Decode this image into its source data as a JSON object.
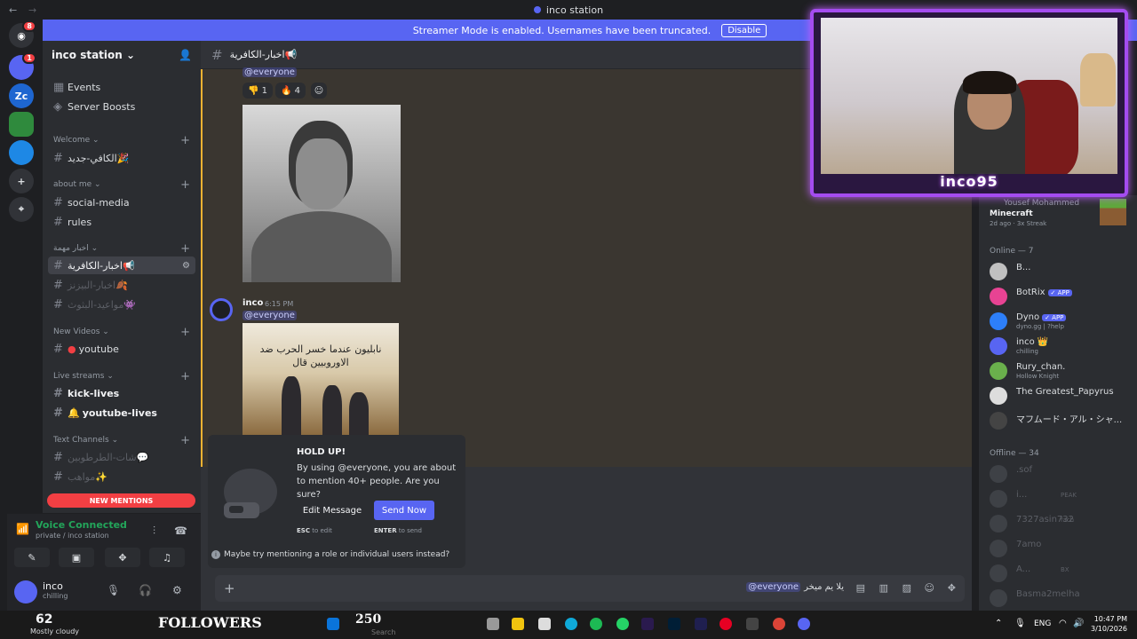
{
  "window": {
    "title": "inco station",
    "back": "←",
    "forward": "→"
  },
  "streamer_banner": {
    "text": "Streamer Mode is enabled. Usernames have been truncated.",
    "button": "Disable"
  },
  "guilds": [
    {
      "label": "",
      "ping": "8",
      "color": "#313338"
    },
    {
      "label": "",
      "ping": "1",
      "color": "#5865f2"
    },
    {
      "label": "Zc",
      "ping": "",
      "color": "#1e66d0"
    },
    {
      "label": "",
      "ping": "",
      "color": "#2f8a3d"
    },
    {
      "label": "",
      "ping": "",
      "color": "#1e88e5"
    },
    {
      "label": "+",
      "ping": "",
      "color": "#313338"
    },
    {
      "label": "⌖",
      "ping": "",
      "color": "#313338"
    }
  ],
  "server": {
    "name": "inco station",
    "chevron": "⌄"
  },
  "sidebar": {
    "events": "Events",
    "boosts": "Server Boosts",
    "welcome_cat": "Welcome",
    "welcome_channel": "الكافي-جديد🎉",
    "aboutme_cat": "about me",
    "social": "social-media",
    "rules": "rules",
    "news_cat": "اخبار مهمة",
    "news_active": "اخبار-الكافرية📢",
    "news2": "اخبار-البيزنز🍂",
    "news3": "مواعيد-البثوث👾",
    "videos_cat": "New Videos",
    "youtube": "youtube",
    "live_cat": "Live streams",
    "kick": "kick-lives",
    "yt_lives": "youtube-lives",
    "text_cat": "Text Channels",
    "chat": "شات-الطرطوبين💬",
    "talents": "مواهب✨",
    "new_mentions": "NEW MENTIONS"
  },
  "voice": {
    "status": "Voice Connected",
    "sub": "private / inco station"
  },
  "user": {
    "name": "inco",
    "status": "chilling"
  },
  "channel": {
    "name": "اخبار-الكافرية📢"
  },
  "messages": {
    "everyone": "@everyone",
    "reaction1_emoji": "👎",
    "reaction1_count": "1",
    "reaction2_emoji": "🔥",
    "reaction2_count": "4",
    "author": "inco",
    "time": "6:15 PM",
    "image2_caption": "نابليون عندما خسر الحرب ضد الاوروبيين قال"
  },
  "holdup": {
    "title": "HOLD UP!",
    "desc": "By using @everyone, you are about to mention 40+ people. Are you sure?",
    "edit": "Edit Message",
    "send": "Send Now",
    "esc_key": "ESC",
    "esc_txt": "to edit",
    "enter_key": "ENTER",
    "enter_txt": "to send",
    "maybe": "Maybe try mentioning a role or individual users instead?"
  },
  "composer": {
    "mention": "@everyone",
    "text": "يلا يم ميخر",
    "plus": "+"
  },
  "activity": {
    "name": "Yousef Mohammed",
    "game": "Minecraft",
    "detail": "2d ago · 3x Streak"
  },
  "members": {
    "online_head": "Online — 7",
    "offline_head": "Offline — 34",
    "online": [
      {
        "name": "B...",
        "status": "",
        "badge": "",
        "color": "#c0c0c0"
      },
      {
        "name": "BotRix",
        "status": "",
        "badge": "✓ APP",
        "color": "#e84393"
      },
      {
        "name": "Dyno",
        "status": "dyno.gg | ?help",
        "badge": "✓ APP",
        "color": "#2d7ff9"
      },
      {
        "name": "inco 👑",
        "status": "chilling",
        "badge": "",
        "color": "#5865f2"
      },
      {
        "name": "Rury_chan.",
        "status": "Hollow Knight",
        "badge": "",
        "color": "#6ab04c"
      },
      {
        "name": "The Greatest_Papyrus",
        "status": "",
        "badge": "",
        "color": "#dddddd"
      },
      {
        "name": "マフムード・アル・シャ...",
        "status": "",
        "badge": "",
        "color": "#444444"
      }
    ],
    "offline": [
      {
        "name": ".sof",
        "status": ""
      },
      {
        "name": "i...",
        "status": "PEAK"
      },
      {
        "name": "7327asin732",
        "status": "fach"
      },
      {
        "name": "7amo",
        "status": ""
      },
      {
        "name": "A...",
        "status": "BX"
      },
      {
        "name": "Basma2melha",
        "status": ""
      }
    ]
  },
  "webcam": {
    "tag": "inco95"
  },
  "taskbar": {
    "weather_temp": "62",
    "weather_text": "Mostly cloudy",
    "followers_label": "FOLLOWERS",
    "followers_count": "250",
    "search": "Search",
    "lang": "ENG",
    "time": "10:47 PM",
    "date": "3/10/2026"
  }
}
